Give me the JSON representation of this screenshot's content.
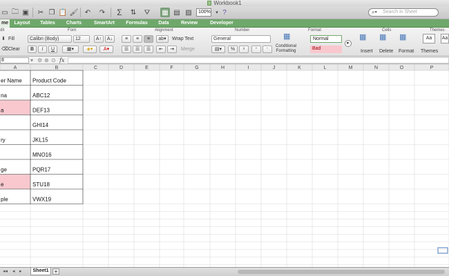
{
  "window": {
    "title": "Workbook1"
  },
  "toolbar": {
    "zoom": "100%",
    "search_placeholder": "Search in Sheet"
  },
  "tabs": [
    {
      "label": "me",
      "active": false
    },
    {
      "label": "Layout",
      "active": false
    },
    {
      "label": "Tables",
      "active": false
    },
    {
      "label": "Charts",
      "active": false
    },
    {
      "label": "SmartArt",
      "active": false
    },
    {
      "label": "Formulas",
      "active": false
    },
    {
      "label": "Data",
      "active": false
    },
    {
      "label": "Review",
      "active": false
    },
    {
      "label": "Developer",
      "active": false
    }
  ],
  "ribbon": {
    "groups": {
      "edit": "dit",
      "font": "Font",
      "alignment": "Alignment",
      "number": "Number",
      "format": "Format",
      "cells": "Cells",
      "themes": "Themes"
    },
    "fill": "Fill",
    "clear": "Clear",
    "font_name": "Calibri (Body)",
    "font_size": "12",
    "wrap_text": "Wrap Text",
    "merge": "Merge",
    "number_format": "General",
    "conditional_formatting": "Conditional\nFormatting",
    "style_normal": "Normal",
    "style_bad": "Bad",
    "insert": "Insert",
    "delete": "Delete",
    "format": "Format",
    "themes": "Themes"
  },
  "formula_bar": {
    "name_box": "8",
    "fx": "fx"
  },
  "sheet": {
    "columns": [
      "A",
      "B",
      "C",
      "D",
      "E",
      "F",
      "G",
      "H",
      "I",
      "J",
      "K",
      "L",
      "M",
      "N",
      "O",
      "P"
    ],
    "rows": [
      {
        "a": "er Name",
        "b": "Product Code",
        "a_bad": false
      },
      {
        "a": "na",
        "b": "ABC12",
        "a_bad": false
      },
      {
        "a": "a",
        "b": "DEF13",
        "a_bad": true
      },
      {
        "a": "",
        "b": "GHI14",
        "a_bad": false
      },
      {
        "a": "ry",
        "b": "JKL15",
        "a_bad": false
      },
      {
        "a": "",
        "b": "MNO16",
        "a_bad": false
      },
      {
        "a": "ge",
        "b": "PQR17",
        "a_bad": false
      },
      {
        "a": "e",
        "b": "STU18",
        "a_bad": true
      },
      {
        "a": "ple",
        "b": "VWX19",
        "a_bad": false
      }
    ],
    "bad_fill": "#f8c8ce"
  },
  "sheet_tabs": [
    {
      "label": "Sheet1"
    }
  ]
}
